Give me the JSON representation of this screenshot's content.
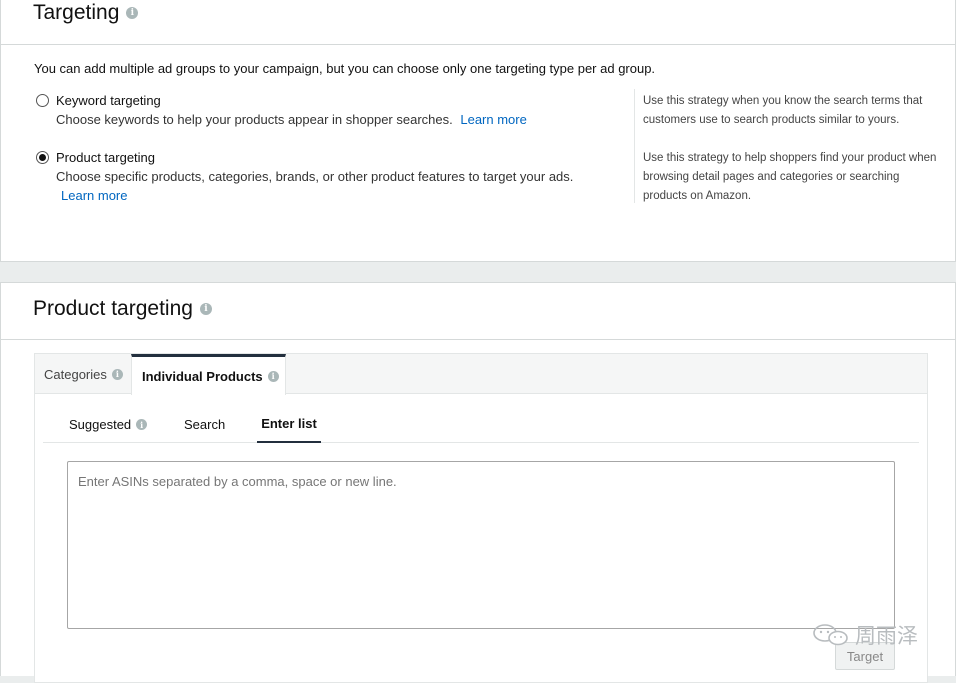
{
  "targeting": {
    "title": "Targeting",
    "intro": "You can add multiple ad groups to your campaign, but you can choose only one targeting type per ad group.",
    "options": [
      {
        "label": "Keyword targeting",
        "description": "Choose keywords to help your products appear in shopper searches.",
        "link": "Learn more",
        "hint": "Use this strategy when you know the search terms that customers use to search products similar to yours.",
        "selected": false
      },
      {
        "label": "Product targeting",
        "description": "Choose specific products, categories, brands, or other product features to target your ads.",
        "link": "Learn more",
        "hint": "Use this strategy to help shoppers find your product when browsing detail pages and categories or searching products on Amazon.",
        "selected": true
      }
    ]
  },
  "product_targeting": {
    "title": "Product targeting",
    "tabs": [
      {
        "label": "Categories",
        "active": false
      },
      {
        "label": "Individual Products",
        "active": true
      }
    ],
    "subtabs": [
      {
        "label": "Suggested",
        "active": false
      },
      {
        "label": "Search",
        "active": false
      },
      {
        "label": "Enter list",
        "active": true
      }
    ],
    "asin_input": {
      "value": "",
      "placeholder": "Enter ASINs separated by a comma, space or new line."
    },
    "target_button": "Target"
  },
  "watermark": {
    "text": "周雨泽",
    "icon": "wechat-icon"
  },
  "colors": {
    "link": "#0066c0",
    "active_tab_border": "#232f3e",
    "info_icon": "#aab7b8"
  }
}
